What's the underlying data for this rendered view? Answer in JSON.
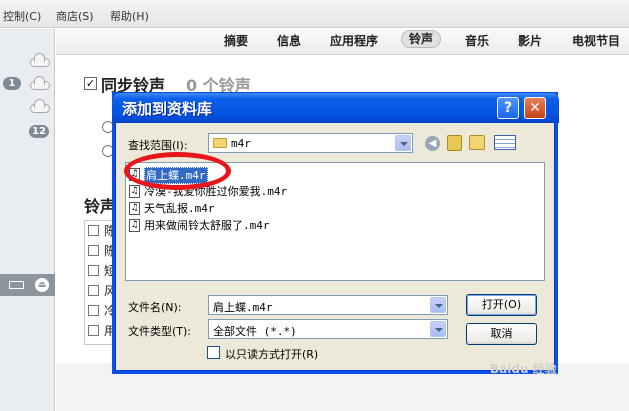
{
  "menubar": {
    "items": [
      "控制(C)",
      "商店(S)",
      "帮助(H)"
    ]
  },
  "sidebar": {
    "badges": [
      "1",
      "12"
    ]
  },
  "tabs": [
    "摘要",
    "信息",
    "应用程序",
    "铃声",
    "音乐",
    "影片",
    "电视节目"
  ],
  "sync": {
    "title": "同步铃声",
    "count": "0 个铃声"
  },
  "ringtones_section": {
    "title": "铃声",
    "rows": [
      "陈",
      "陈",
      "短",
      "风",
      "冷",
      "用"
    ]
  },
  "dialog": {
    "title": "添加到资料库",
    "help_label": "?",
    "close_label": "✕",
    "lookin_label": "查找范围(I):",
    "lookin_value": "m4r",
    "files": [
      {
        "name": "肩上蝶.m4r",
        "selected": true
      },
      {
        "name": "冷漠-我爱你胜过你爱我.m4r",
        "selected": false
      },
      {
        "name": "天气乱报.m4r",
        "selected": false
      },
      {
        "name": "用来做闹铃太舒服了.m4r",
        "selected": false
      }
    ],
    "filename_label": "文件名(N):",
    "filename_value": "肩上蝶.m4r",
    "filetype_label": "文件类型(T):",
    "filetype_value": "全部文件 (*.*)",
    "open_button": "打开(O)",
    "cancel_button": "取消",
    "readonly_label": "以只读方式打开(R)"
  },
  "watermark": "Baidu 经验",
  "colors": {
    "xp_title_blue": "#0554e3",
    "highlight": "#316ac5",
    "annotation_red": "#e8151b"
  }
}
